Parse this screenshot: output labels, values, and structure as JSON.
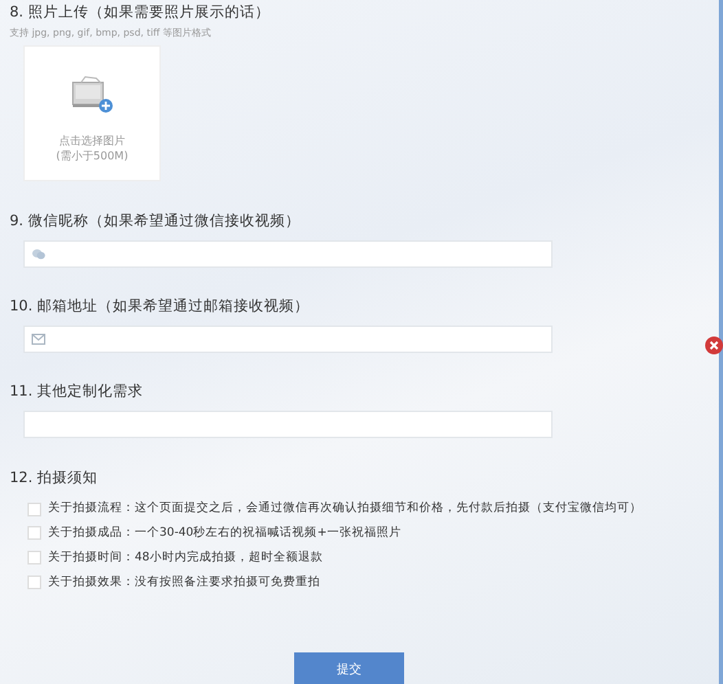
{
  "upload": {
    "label": "8. 照片上传（如果需要照片展示的话）",
    "hint": "支持 jpg, png, gif, bmp, psd, tiff 等图片格式",
    "caption": "点击选择图片",
    "limit": "(需小于500M)"
  },
  "fields": [
    {
      "label": "9. 微信昵称（如果希望通过微信接收视频）",
      "kind": "wechat"
    },
    {
      "label": "10. 邮箱地址（如果希望通过邮箱接收视频）",
      "kind": "email"
    },
    {
      "label": "11. 其他定制化需求",
      "kind": "plain"
    }
  ],
  "notice": {
    "label": "12. 拍摄须知",
    "items": [
      {
        "text": "关于拍摄流程：这个页面提交之后，会通过微信再次确认拍摄细节和价格，先付款后拍摄（支付宝微信均可）",
        "checked": false
      },
      {
        "text": "关于拍摄成品：一个30-40秒左右的祝福喊话视频+一张祝福照片",
        "checked": false
      },
      {
        "text": "关于拍摄时间：48小时内完成拍摄，超时全额退款",
        "checked": false
      },
      {
        "text": "关于拍摄效果：没有按照备注要求拍摄可免费重拍",
        "checked": false
      }
    ]
  },
  "submit": "提交"
}
